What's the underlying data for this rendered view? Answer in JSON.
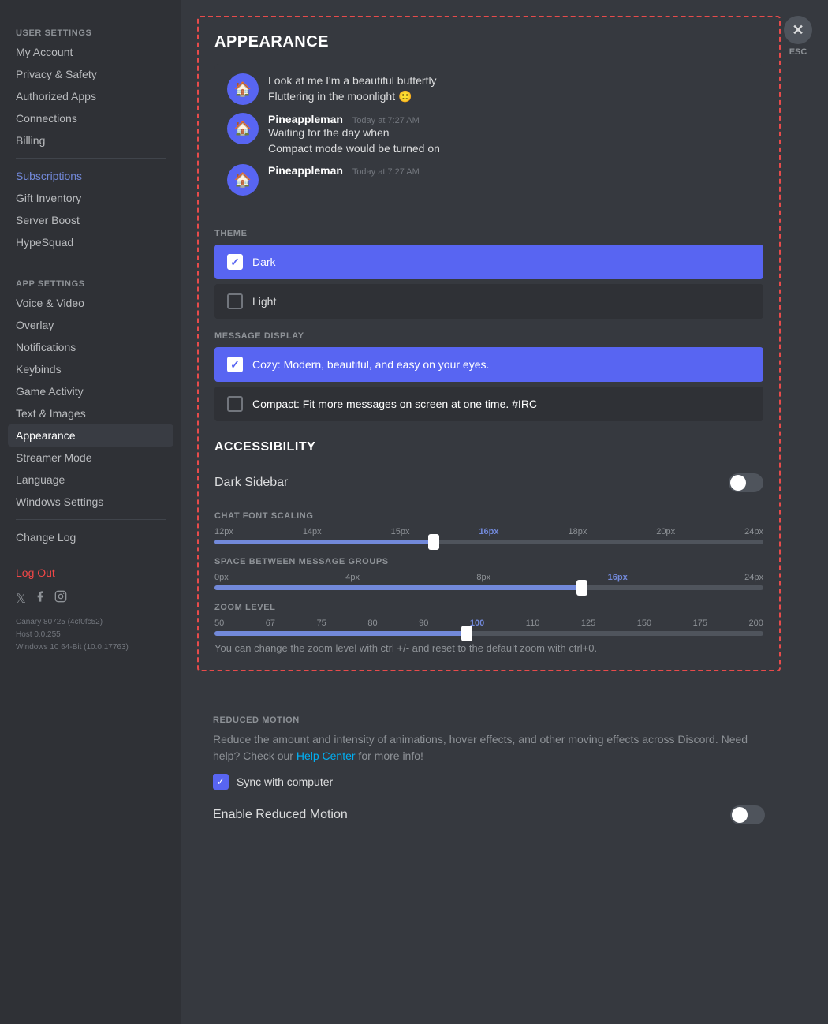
{
  "sidebar": {
    "user_settings_label": "USER SETTINGS",
    "app_settings_label": "APP SETTINGS",
    "items": {
      "my_account": "My Account",
      "privacy_safety": "Privacy & Safety",
      "authorized_apps": "Authorized Apps",
      "connections": "Connections",
      "billing": "Billing",
      "subscriptions": "Subscriptions",
      "gift_inventory": "Gift Inventory",
      "server_boost": "Server Boost",
      "hypesquad": "HypeSquad",
      "voice_video": "Voice & Video",
      "overlay": "Overlay",
      "notifications": "Notifications",
      "keybinds": "Keybinds",
      "game_activity": "Game Activity",
      "text_images": "Text & Images",
      "appearance": "Appearance",
      "streamer_mode": "Streamer Mode",
      "language": "Language",
      "windows_settings": "Windows Settings",
      "change_log": "Change Log",
      "log_out": "Log Out"
    }
  },
  "esc": {
    "label": "ESC"
  },
  "appearance": {
    "title": "APPEARANCE",
    "preview": {
      "messages": [
        {
          "avatar_emoji": "🏠",
          "author": "",
          "time": "",
          "lines": [
            "Look at me I'm a beautiful butterfly",
            "Fluttering in the moonlight 🙂"
          ]
        },
        {
          "avatar_emoji": "🏠",
          "author": "Pineappleman",
          "time": "Today at 7:27 AM",
          "lines": [
            "Waiting for the day when",
            "Compact mode would be turned on"
          ]
        },
        {
          "avatar_emoji": "🏠",
          "author": "Pineappleman",
          "time": "Today at 7:27 AM",
          "lines": []
        }
      ]
    },
    "theme_label": "THEME",
    "themes": [
      {
        "id": "dark",
        "label": "Dark",
        "selected": true
      },
      {
        "id": "light",
        "label": "Light",
        "selected": false
      }
    ],
    "message_display_label": "MESSAGE DISPLAY",
    "message_displays": [
      {
        "id": "cozy",
        "label": "Cozy: Modern, beautiful, and easy on your eyes.",
        "selected": true
      },
      {
        "id": "compact",
        "label": "Compact: Fit more messages on screen at one time. #IRC",
        "selected": false
      }
    ],
    "accessibility_title": "ACCESSIBILITY",
    "dark_sidebar_label": "Dark Sidebar",
    "chat_font_scaling_label": "CHAT FONT SCALING",
    "font_sizes": [
      "12px",
      "14px",
      "15px",
      "16px",
      "18px",
      "20px",
      "24px"
    ],
    "font_current": "16px",
    "font_fill_pct": 40,
    "font_thumb_pct": 40,
    "space_between_label": "SPACE BETWEEN MESSAGE GROUPS",
    "space_sizes": [
      "0px",
      "4px",
      "8px",
      "16px",
      "24px"
    ],
    "space_current": "16px",
    "space_fill_pct": 67,
    "space_thumb_pct": 67,
    "zoom_label": "ZOOM LEVEL",
    "zoom_values": [
      "50",
      "67",
      "75",
      "80",
      "90",
      "100",
      "110",
      "125",
      "150",
      "175",
      "200"
    ],
    "zoom_current": "100",
    "zoom_fill_pct": 46,
    "zoom_thumb_pct": 46,
    "zoom_hint": "You can change the zoom level with ctrl +/- and reset to the default zoom with ctrl+0."
  },
  "reduced_motion": {
    "label": "REDUCED MOTION",
    "description": "Reduce the amount and intensity of animations, hover effects, and other moving effects across Discord. Need help? Check our ",
    "link_text": "Help Center",
    "description_end": " for more info!",
    "sync_label": "Sync with computer",
    "enable_label": "Enable Reduced Motion"
  },
  "version": {
    "line1": "Canary 80725 (4cf0fc52)",
    "line2": "Host 0.0.255",
    "line3": "Windows 10 64-Bit (10.0.17763)"
  }
}
